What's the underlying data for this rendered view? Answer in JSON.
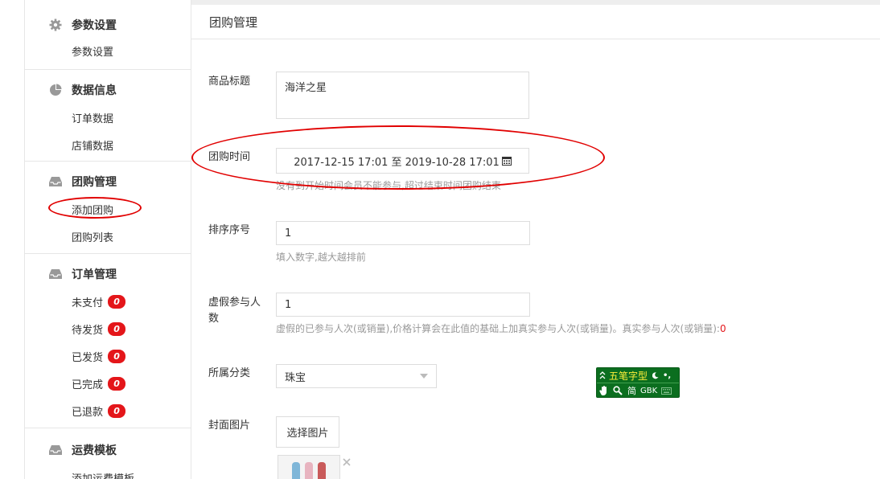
{
  "sidebar": {
    "groups": [
      {
        "title": "参数设置",
        "icon": "gear-icon",
        "items": [
          {
            "label": "参数设置"
          }
        ]
      },
      {
        "title": "数据信息",
        "icon": "pie-chart-icon",
        "items": [
          {
            "label": "订单数据"
          },
          {
            "label": "店铺数据"
          }
        ]
      },
      {
        "title": "团购管理",
        "icon": "inbox-icon",
        "items": [
          {
            "label": "添加团购"
          },
          {
            "label": "团购列表"
          }
        ]
      },
      {
        "title": "订单管理",
        "icon": "inbox-icon",
        "items": [
          {
            "label": "未支付",
            "badge": "0"
          },
          {
            "label": "待发货",
            "badge": "0"
          },
          {
            "label": "已发货",
            "badge": "0"
          },
          {
            "label": "已完成",
            "badge": "0"
          },
          {
            "label": "已退款",
            "badge": "0"
          }
        ]
      },
      {
        "title": "运费模板",
        "icon": "inbox-icon",
        "items": [
          {
            "label": "添加运费模板"
          }
        ]
      }
    ]
  },
  "header": {
    "title": "团购管理"
  },
  "form": {
    "title_label": "商品标题",
    "title_value": "海洋之星",
    "time_label": "团购时间",
    "time_value": "2017-12-15 17:01 至 2019-10-28 17:01",
    "time_hint": "没有到开始时间会员不能参与,超过结束时间团购结束",
    "sort_label": "排序序号",
    "sort_value": "1",
    "sort_hint": "填入数字,越大越排前",
    "fake_label": "虚假参与人数",
    "fake_value": "1",
    "fake_hint": "虚假的已参与人次(或销量),价格计算会在此值的基础上加真实参与人次(或销量)。真实参与人次(或销量):",
    "fake_hint_count": "0",
    "category_label": "所属分类",
    "category_value": "珠宝",
    "cover_label": "封面图片",
    "cover_button": "选择图片"
  },
  "ime": {
    "mode": "五笔字型",
    "simplified": "简",
    "encoding": "GBK"
  },
  "colors": {
    "badge": "#e4161a",
    "annotation": "#e10000",
    "ime_bg": "#0b6e1f"
  }
}
